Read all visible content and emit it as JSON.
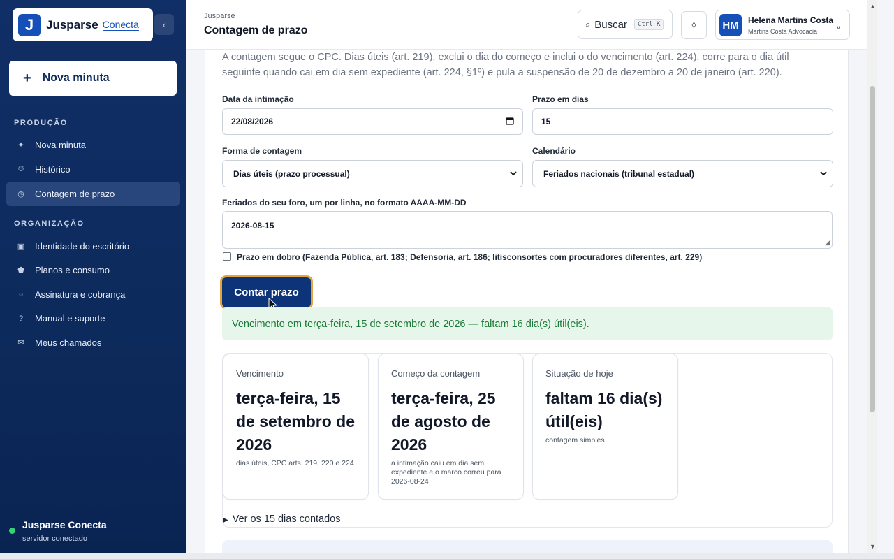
{
  "brand": {
    "logo_letter": "J",
    "name": "Jusparse",
    "sub": "Conecta",
    "collapse": "‹"
  },
  "sidebar": {
    "new_draft": {
      "icon": "+",
      "label": "Nova minuta"
    },
    "sections": [
      {
        "label": "PRODUÇÃO",
        "items": [
          {
            "icon": "✦",
            "label": "Nova minuta"
          },
          {
            "icon": "⏱",
            "label": "Histórico"
          },
          {
            "icon": "◷",
            "label": "Contagem de prazo",
            "active": true
          }
        ]
      },
      {
        "label": "ORGANIZAÇÃO",
        "items": [
          {
            "icon": "▣",
            "label": "Identidade do escritório"
          },
          {
            "icon": "⬟",
            "label": "Planos e consumo"
          },
          {
            "icon": "¤",
            "label": "Assinatura e cobrança"
          },
          {
            "icon": "?",
            "label": "Manual e suporte"
          },
          {
            "icon": "✉",
            "label": "Meus chamados"
          }
        ]
      }
    ],
    "status": {
      "name": "Jusparse Conecta",
      "text": "servidor conectado",
      "color": "#35d27a"
    }
  },
  "header": {
    "breadcrumb": "Jusparse",
    "title": "Contagem de prazo",
    "search": {
      "icon": "⌕",
      "label": "Buscar",
      "shortcut": "Ctrl K"
    },
    "theme_icon": "◊",
    "user": {
      "initials": "HM",
      "name": "Helena Martins Costa",
      "org": "Martins Costa Advocacia",
      "chevron": "v"
    }
  },
  "form": {
    "intro": "A contagem segue o CPC. Dias úteis (art. 219), exclui o dia do começo e inclui o do vencimento (art. 224), corre para o dia útil seguinte quando cai em dia sem expediente (art. 224, §1º) e pula a suspensão de 20 de dezembro a 20 de janeiro (art. 220).",
    "intimation_label": "Data da intimação",
    "intimation_value": "22/08/2026",
    "days_label": "Prazo em dias",
    "days_value": "15",
    "mode_label": "Forma de contagem",
    "mode_value": "Dias úteis (prazo processual)",
    "calendar_label": "Calendário",
    "calendar_value": "Feriados nacionais (tribunal estadual)",
    "holidays_label": "Feriados do seu foro, um por linha, no formato AAAA-MM-DD",
    "holidays_value": "2026-08-15",
    "double_label": "Prazo em dobro (Fazenda Pública, art. 183; Defensoria, art. 186; litisconsortes com procuradores diferentes, art. 229)",
    "submit_label": "Contar prazo"
  },
  "result": {
    "banner": "Vencimento em terça-feira, 15 de setembro de 2026 — faltam 16 dia(s) útil(eis).",
    "cards": [
      {
        "label": "Vencimento",
        "value": "terça-feira, 15 de setembro de 2026",
        "note": "dias úteis, CPC arts. 219, 220 e 224"
      },
      {
        "label": "Começo da contagem",
        "value": "terça-feira, 25 de agosto de 2026",
        "note": "a intimação caiu em dia sem expediente e o marco correu para 2026-08-24"
      },
      {
        "label": "Situação de hoje",
        "value": "faltam 16 dia(s) útil(eis)",
        "note": "contagem simples"
      }
    ],
    "details": "Ver os 15 dias contados"
  },
  "colors": {
    "sidebar": "#102f66",
    "accent": "#1450b8",
    "button": "#0d3479",
    "button_border": "#e4a63a",
    "success_bg": "#e6f6ea",
    "success_text": "#1a7a36"
  }
}
